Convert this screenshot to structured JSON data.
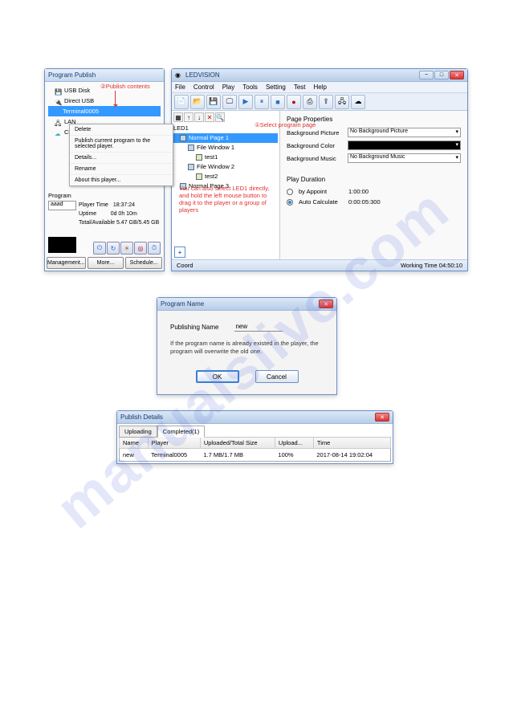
{
  "watermark": "manualslive.com",
  "publish": {
    "title": "Program Publish",
    "tree": {
      "usb_disk": "USB Disk",
      "direct_usb": "Direct USB",
      "terminal": "Terminal0005",
      "lan": "LAN",
      "cloud": "Cloud"
    },
    "context_menu": {
      "delete": "Delete",
      "publish": "Publish current program to the selected player.",
      "details": "Details...",
      "rename": "Rename",
      "about": "About this player..."
    },
    "program_section": {
      "label": "Program",
      "dropdown_value": "aaad",
      "player_time_label": "Player Time",
      "player_time": "18:37:24",
      "uptime_label": "Uptime",
      "uptime": "0d 0h 10m",
      "total_label": "Total/Available",
      "total": "5.47 GB/5.45 GB"
    },
    "buttons": {
      "management": "Management...",
      "more": "More...",
      "schedule": "Schedule..."
    }
  },
  "ledvision": {
    "title": "LEDVISION",
    "menu": {
      "file": "File",
      "control": "Control",
      "play": "Play",
      "tools": "Tools",
      "setting": "Setting",
      "test": "Test",
      "help": "Help"
    },
    "tree": {
      "root": "LED1",
      "page1": "Normal Page 1",
      "win1": "File Window 1",
      "test1": "test1",
      "win2": "File Window 2",
      "test2": "test2",
      "page3": "Normal Page 3"
    },
    "props": {
      "title": "Page Properties",
      "bg_picture_label": "Background Picture",
      "bg_picture": "No Background Picture",
      "bg_color_label": "Background Color",
      "bg_music_label": "Background Music",
      "bg_music": "No Background Music",
      "duration_title": "Play Duration",
      "by_appoint": "by Appoint",
      "by_appoint_val": "1:00:00",
      "auto_calc": "Auto Calculate",
      "auto_calc_val": "0:00:05:300"
    },
    "status": {
      "coord": "Coord",
      "worktime_label": "Working Time",
      "worktime": "04:50:10"
    }
  },
  "annotations": {
    "a1": "②Publish contents",
    "a2": "①Select program page",
    "a3": "You can also select LED1 directly, and hold the left mouse button to drag it to the player or a group of players"
  },
  "dialog": {
    "title": "Program Name",
    "label": "Publishing Name",
    "value": "new",
    "note": "If the program name is already existed in the player, the program will overwrite the old one.",
    "ok": "OK",
    "cancel": "Cancel"
  },
  "details": {
    "title": "Publish Details",
    "tabs": {
      "uploading": "Uploading",
      "completed": "Completed(1)"
    },
    "headers": {
      "name": "Name",
      "player": "Player",
      "size": "Uploaded/Total Size",
      "uploadpct": "Upload...",
      "time": "Time"
    },
    "row": {
      "name": "new",
      "player": "Terminal0005",
      "size": "1.7 MB/1.7 MB",
      "uploadpct": "100%",
      "time": "2017-08-14 19:02:04"
    }
  }
}
